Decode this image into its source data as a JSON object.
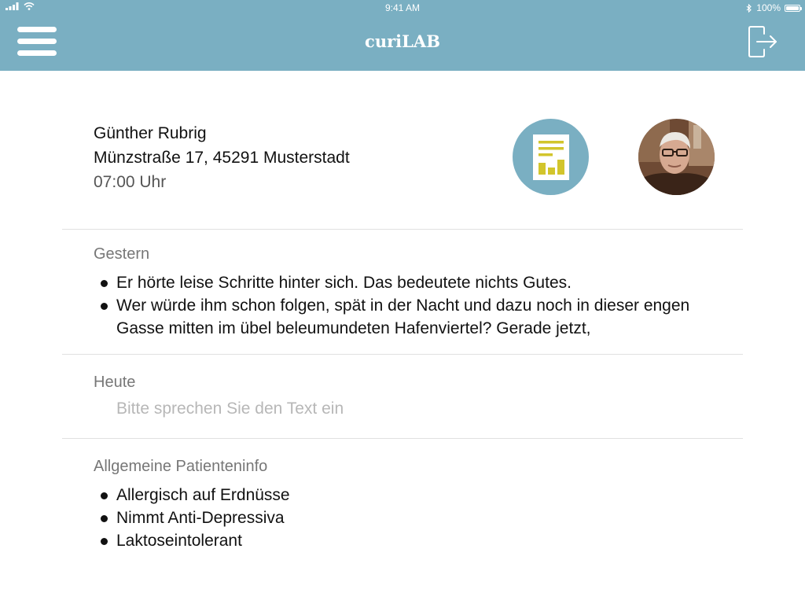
{
  "status_bar": {
    "time": "9:41 AM",
    "battery": "100%",
    "battery_level": 1.0
  },
  "nav": {
    "title": "curiLAB",
    "menu_icon": "hamburger-menu-icon",
    "logout_icon": "logout-icon"
  },
  "patient": {
    "name": "Günther Rubrig",
    "address": "Münzstraße 17, 45291 Musterstadt",
    "time": "07:00 Uhr",
    "report_icon": "report-document-icon"
  },
  "sections": {
    "yesterday": {
      "title": "Gestern",
      "items": [
        "Er hörte leise Schritte hinter sich. Das bedeutete nichts Gutes.",
        "Wer würde ihm schon folgen, spät in der Nacht und dazu noch in dieser engen Gasse mitten im übel beleumundeten Hafenviertel? Gerade jetzt,"
      ]
    },
    "today": {
      "title": "Heute",
      "placeholder": "Bitte sprechen Sie den Text ein"
    },
    "general": {
      "title": "Allgemeine Patienteninfo",
      "items": [
        "Allergisch auf Erdnüsse",
        "Nimmt Anti-Depressiva",
        "Laktoseintolerant"
      ]
    }
  },
  "colors": {
    "accent": "#7aafc2",
    "report_icon_yellow": "#d2c52c"
  }
}
